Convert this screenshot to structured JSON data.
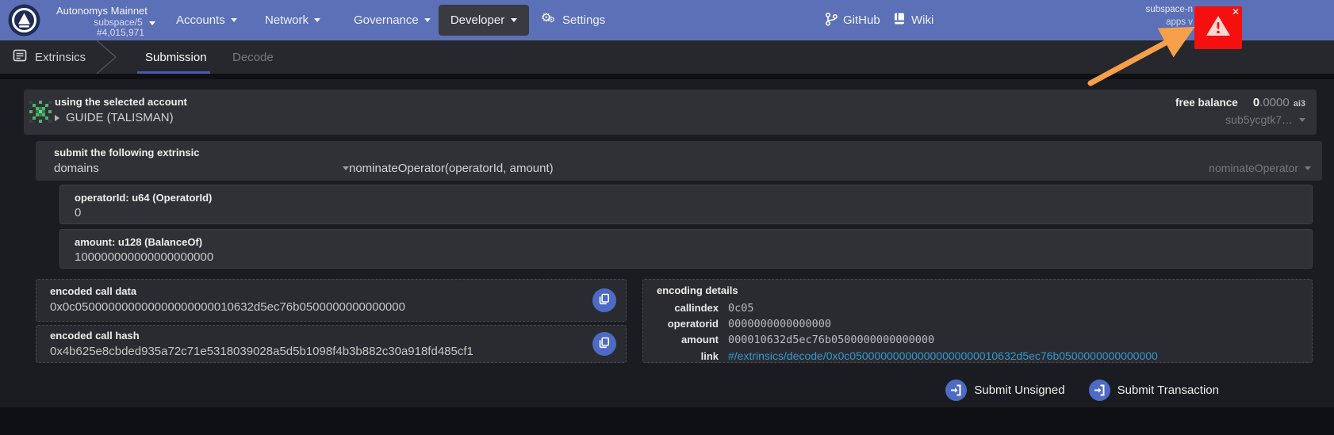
{
  "header": {
    "app": {
      "name": "Autonomys Mainnet",
      "network": "subspace/5",
      "block_number": "#4,015,971"
    },
    "menu": [
      {
        "label": "Accounts"
      },
      {
        "label": "Network"
      },
      {
        "label": "Governance"
      },
      {
        "label": "Developer",
        "active": true
      },
      {
        "label": "Settings"
      }
    ],
    "external_links": [
      {
        "label": "GitHub"
      },
      {
        "label": "Wiki"
      }
    ],
    "node_text_line1": "subspace-n",
    "node_text_line2": "apps v",
    "warning_close": "✕"
  },
  "tabbar": {
    "section": "Extrinsics",
    "tabs": [
      {
        "label": "Submission",
        "active": true
      },
      {
        "label": "Decode",
        "active": false
      }
    ]
  },
  "account": {
    "caption": "using the selected account",
    "name": "GUIDE (TALISMAN)",
    "free_balance_label": "free balance",
    "balance_int": "0",
    "balance_frac": ".0000",
    "balance_unit": "ai3",
    "address": "sub5ycgtk7…"
  },
  "extrinsic": {
    "caption": "submit the following extrinsic",
    "pallet": "domains",
    "signature": "nominateOperator(operatorId, amount)",
    "method": "nominateOperator",
    "params": [
      {
        "label": "operatorId: u64 (OperatorId)",
        "value": "0"
      },
      {
        "label": "amount: u128 (BalanceOf)",
        "value": "100000000000000000000"
      }
    ]
  },
  "outputs": {
    "call_data_label": "encoded call data",
    "call_data": "0x0c050000000000000000000010632d5ec76b0500000000000000",
    "call_hash_label": "encoded call hash",
    "call_hash": "0x4b625e8cbded935a72c71e5318039028a5d5b1098f4b3b882c30a918fd485cf1"
  },
  "encoding_details": {
    "title": "encoding details",
    "rows": [
      {
        "label": "callindex",
        "value": "0c05"
      },
      {
        "label": "operatorid",
        "value": "0000000000000000"
      },
      {
        "label": "amount",
        "value": "000010632d5ec76b0500000000000000"
      },
      {
        "label": "link",
        "value": "#/extrinsics/decode/0x0c050000000000000000000010632d5ec76b0500000000000000"
      }
    ]
  },
  "actions": {
    "unsigned": "Submit Unsigned",
    "transaction": "Submit Transaction"
  },
  "icons": {
    "settings_glyph": "⚙"
  },
  "colors": {
    "header_blue": "#5b70b6",
    "accent_button": "#4d6bc4",
    "active_tab_underline": "#4a5ba8",
    "warning_red": "#f50f0f",
    "link_blue": "#3699cf",
    "annotation_arrow_orange": "#f6a04b",
    "identicon_green": "#52b06a"
  }
}
